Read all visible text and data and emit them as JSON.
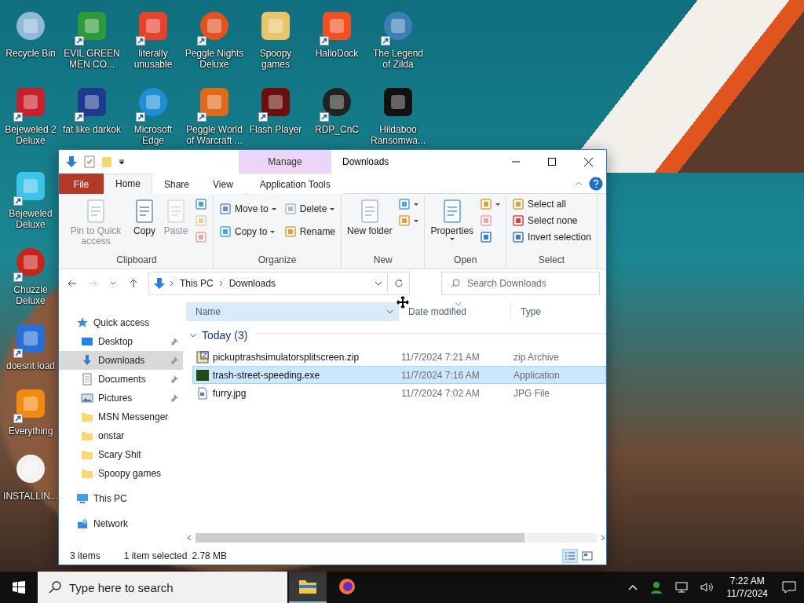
{
  "desktop_icons": [
    {
      "label": "Recycle Bin",
      "shortcut": false
    },
    {
      "label": "EVIL GREEN MEN CO...",
      "shortcut": true
    },
    {
      "label": "literally unusable",
      "shortcut": true
    },
    {
      "label": "Peggle Nights Deluxe",
      "shortcut": true
    },
    {
      "label": "Spoopy games",
      "shortcut": false
    },
    {
      "label": "HalloDock",
      "shortcut": true
    },
    {
      "label": "The Legend of Zilda",
      "shortcut": true
    },
    {
      "label": "Bejeweled 2 Deluxe",
      "shortcut": true
    },
    {
      "label": "fat like darkok",
      "shortcut": true
    },
    {
      "label": "Microsoft Edge",
      "shortcut": true
    },
    {
      "label": "Peggle World of Warcraft ...",
      "shortcut": true
    },
    {
      "label": "Flash Player",
      "shortcut": true
    },
    {
      "label": "RDP_CnC",
      "shortcut": true
    },
    {
      "label": "Hildaboo Ransomwa...",
      "shortcut": false
    },
    {
      "label": "Bejeweled Deluxe",
      "shortcut": true
    },
    {
      "label": "Chuzzle Deluxe",
      "shortcut": true
    },
    {
      "label": "doesnt load",
      "shortcut": true
    },
    {
      "label": "Everything",
      "shortcut": true
    },
    {
      "label": "INSTALLIN...",
      "shortcut": false
    }
  ],
  "window": {
    "title": "Downloads",
    "context_group": "Manage",
    "tabs": [
      {
        "label": "File",
        "kind": "file",
        "selected": false
      },
      {
        "label": "Home",
        "kind": "normal",
        "selected": true
      },
      {
        "label": "Share",
        "kind": "normal",
        "selected": false
      },
      {
        "label": "View",
        "kind": "normal",
        "selected": false
      },
      {
        "label": "Application Tools",
        "kind": "context",
        "selected": false
      }
    ],
    "ribbon": [
      {
        "label": "Clipboard",
        "commands": [
          {
            "kind": "large",
            "label": "Pin to Quick access",
            "disabled": true,
            "dropdown": false
          },
          {
            "kind": "large",
            "label": "Copy",
            "disabled": false,
            "dropdown": false
          },
          {
            "kind": "large",
            "label": "Paste",
            "disabled": true,
            "dropdown": false
          },
          {
            "kind": "icon",
            "disabled": false,
            "dropdown": false
          },
          {
            "kind": "icon",
            "disabled": true,
            "dropdown": false
          },
          {
            "kind": "icon",
            "disabled": true,
            "dropdown": false
          }
        ]
      },
      {
        "label": "Organize",
        "commands": [
          {
            "kind": "small",
            "label": "Move to",
            "disabled": false,
            "dropdown": true
          },
          {
            "kind": "small",
            "label": "Delete",
            "disabled": false,
            "dropdown": true
          },
          {
            "kind": "small",
            "label": "Copy to",
            "disabled": false,
            "dropdown": true
          },
          {
            "kind": "small",
            "label": "Rename",
            "disabled": false,
            "dropdown": false
          }
        ]
      },
      {
        "label": "New",
        "commands": [
          {
            "kind": "large",
            "label": "New folder",
            "disabled": false,
            "dropdown": false
          },
          {
            "kind": "icon",
            "disabled": false,
            "dropdown": true
          },
          {
            "kind": "icon",
            "disabled": false,
            "dropdown": true
          }
        ]
      },
      {
        "label": "Open",
        "commands": [
          {
            "kind": "large",
            "label": "Properties",
            "disabled": false,
            "dropdown": true
          },
          {
            "kind": "icon",
            "disabled": false,
            "dropdown": true
          },
          {
            "kind": "icon",
            "disabled": true,
            "dropdown": false
          },
          {
            "kind": "icon",
            "disabled": false,
            "dropdown": false
          }
        ]
      },
      {
        "label": "Select",
        "commands": [
          {
            "kind": "small",
            "label": "Select all",
            "disabled": false,
            "dropdown": false
          },
          {
            "kind": "small",
            "label": "Select none",
            "disabled": false,
            "dropdown": false
          },
          {
            "kind": "small",
            "label": "Invert selection",
            "disabled": false,
            "dropdown": false
          }
        ]
      }
    ],
    "address": {
      "path": [
        "This PC",
        "Downloads"
      ]
    },
    "search": {
      "placeholder": "Search Downloads"
    },
    "nav": [
      {
        "label": "Quick access",
        "kind": "star",
        "pinned": false,
        "selected": false,
        "children": [
          {
            "label": "Desktop",
            "kind": "desktop",
            "pinned": true,
            "selected": false
          },
          {
            "label": "Downloads",
            "kind": "download",
            "pinned": true,
            "selected": true
          },
          {
            "label": "Documents",
            "kind": "document",
            "pinned": true,
            "selected": false
          },
          {
            "label": "Pictures",
            "kind": "picture",
            "pinned": true,
            "selected": false
          },
          {
            "label": "MSN Messenger",
            "kind": "folder",
            "pinned": false,
            "selected": false
          },
          {
            "label": "onstar",
            "kind": "folder",
            "pinned": false,
            "selected": false
          },
          {
            "label": "Scary Shit",
            "kind": "folder",
            "pinned": false,
            "selected": false
          },
          {
            "label": "Spoopy games",
            "kind": "folder",
            "pinned": false,
            "selected": false
          }
        ]
      },
      {
        "label": "This PC",
        "kind": "pc",
        "pinned": false,
        "selected": false
      },
      {
        "label": "Network",
        "kind": "network",
        "pinned": false,
        "selected": false
      }
    ],
    "columns": [
      {
        "label": "Name",
        "hovered": true,
        "sorted": false
      },
      {
        "label": "Date modified",
        "hovered": false,
        "sorted": true
      },
      {
        "label": "Type",
        "hovered": false,
        "sorted": false
      }
    ],
    "groups": [
      {
        "label": "Today (3)",
        "expanded": true,
        "files": [
          {
            "name": "pickuptrashsimulatorsplitscreen.zip",
            "kind": "zip",
            "date": "11/7/2024 7:21 AM",
            "type": "zip Archive",
            "selected": false
          },
          {
            "name": "trash-street-speeding.exe",
            "kind": "exe",
            "date": "11/7/2024 7:16 AM",
            "type": "Application",
            "selected": true
          },
          {
            "name": "furry.jpg",
            "kind": "image",
            "date": "11/7/2024 7:02 AM",
            "type": "JPG File",
            "selected": false
          }
        ]
      }
    ],
    "status": {
      "count": "3 items",
      "selection": "1 item selected",
      "size": "2.78 MB"
    },
    "view_modes": [
      {
        "kind": "details",
        "selected": true
      },
      {
        "kind": "tiles",
        "selected": false
      }
    ]
  },
  "taskbar": {
    "search": {
      "placeholder": "Type here to search"
    },
    "apps": [
      {
        "kind": "explorer",
        "active": true
      },
      {
        "kind": "firefox",
        "active": false
      }
    ],
    "time": "7:22 AM",
    "date": "11/7/2024"
  }
}
